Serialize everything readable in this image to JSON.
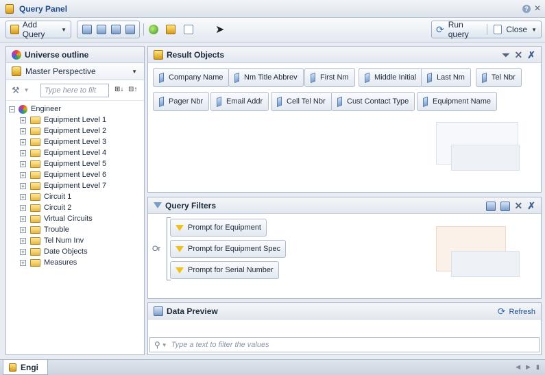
{
  "window": {
    "title": "Query Panel"
  },
  "toolbar": {
    "add_query_label": "Add Query",
    "run_query_label": "Run query",
    "close_label": "Close"
  },
  "outline": {
    "title": "Universe outline",
    "perspective": "Master Perspective",
    "filter_placeholder": "Type here to filt",
    "root": "Engineer",
    "items": [
      "Equipment Level 1",
      "Equipment Level 2",
      "Equipment Level 3",
      "Equipment Level 4",
      "Equipment Level 5",
      "Equipment Level 6",
      "Equipment Level 7",
      "Circuit 1",
      "Circuit 2",
      "Virtual Circuits",
      "Trouble",
      "Tel Num Inv",
      "Date Objects",
      "Measures"
    ]
  },
  "result_objects": {
    "title": "Result Objects",
    "row1": [
      "Company Name",
      "Nm Title Abbrev",
      "First Nm",
      "Middle Initial",
      "Last Nm",
      "Tel Nbr"
    ],
    "row2": [
      "Pager Nbr",
      "Email Addr",
      "Cell Tel Nbr",
      "Cust Contact Type",
      "Equipment Name"
    ]
  },
  "query_filters": {
    "title": "Query Filters",
    "operator": "Or",
    "prompts": [
      "Prompt for Equipment",
      "Prompt for Equipment Spec",
      "Prompt for Serial Number"
    ]
  },
  "data_preview": {
    "title": "Data Preview",
    "refresh_label": "Refresh",
    "search_placeholder": "Type a text to filter the values"
  },
  "bottom_tab": {
    "label": "Engi"
  }
}
